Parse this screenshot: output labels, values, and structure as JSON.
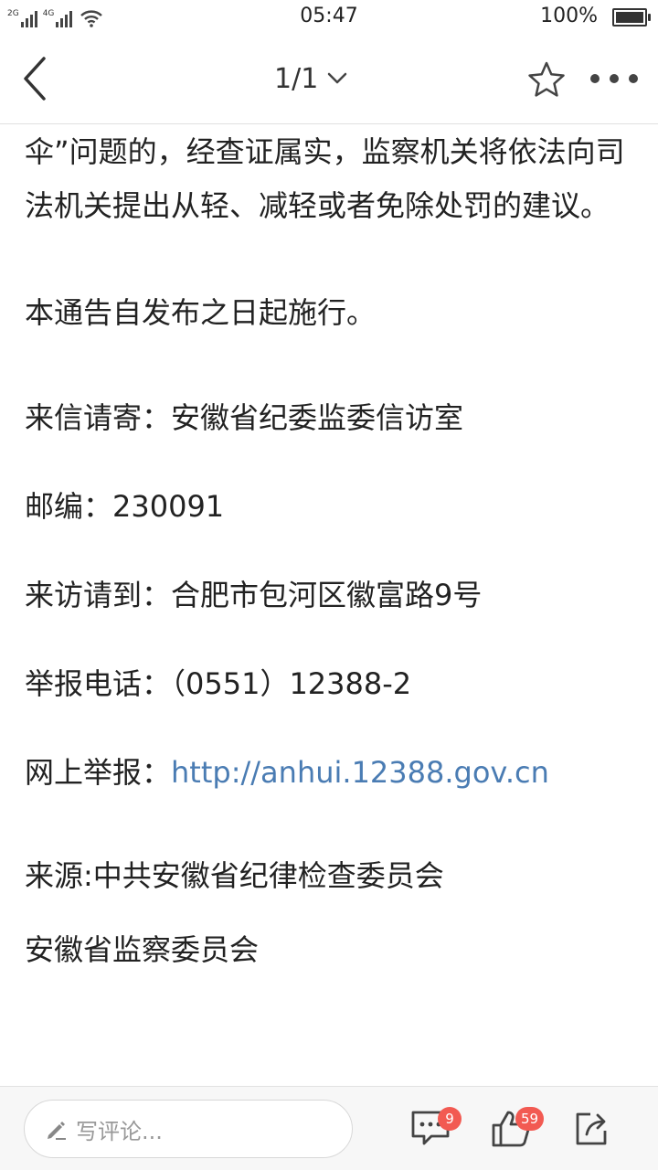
{
  "status_bar": {
    "network_1": "2G",
    "network_2": "4G",
    "time": "05:47",
    "battery_percent": "100%",
    "battery_level": 1.0
  },
  "nav": {
    "page_indicator": "1/1",
    "icons": [
      "back-arrow-icon",
      "chevron-down-icon",
      "star-icon",
      "more-icon"
    ]
  },
  "article": {
    "paragraphs": [
      "伞”问题的，经查证属实，监察机关将依法向司法机关提出从轻、减轻或者免除处罚的建议。",
      "本通告自发布之日起施行。",
      "来信请寄：安徽省纪委监委信访室",
      "邮编：230091",
      "来访请到：合肥市包河区徽富路9号",
      "举报电话：（0551）12388-2"
    ],
    "online_report_label": "网上举报：",
    "online_report_url": "http://anhui.12388.gov.cn",
    "source_line_1": "来源:中共安徽省纪律检查委员会",
    "source_line_2": "安徽省监察委员会"
  },
  "bottom_bar": {
    "comment_placeholder": "写评论...",
    "comment_count": "9",
    "like_count": "59",
    "badge_color": "#f25a52"
  },
  "colors": {
    "link": "#4a7cb3",
    "text": "#222222"
  }
}
